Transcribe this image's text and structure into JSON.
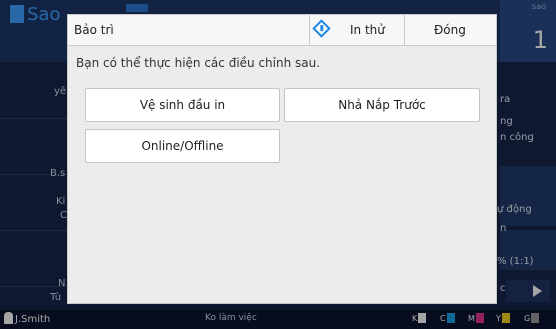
{
  "background": {
    "app_title": "Sao",
    "count": "1",
    "corner_label": "sao",
    "left_labels": [
      "yê",
      "B.s",
      "Ki",
      "C",
      "N",
      "Tù"
    ],
    "right_labels": [
      "ra",
      "ng",
      "n công",
      "ự động",
      "n",
      "% (1:1)",
      "c"
    ],
    "user": "J.Smith",
    "status": "Ko làm việc",
    "inks": [
      "K",
      "C",
      "M",
      "Y",
      "G"
    ],
    "ink_colors": [
      "#222222",
      "#19a7e8",
      "#e8328c",
      "#f2d21b",
      "#888888"
    ]
  },
  "dialog": {
    "title": "Bảo trì",
    "test_print_label": "In thử",
    "close_label": "Đóng",
    "message": "Bạn có thể thực hiện các điều chỉnh sau.",
    "options": [
      "Vệ sinh đầu in",
      "Nhả Nắp Trước",
      "Online/Offline"
    ]
  }
}
